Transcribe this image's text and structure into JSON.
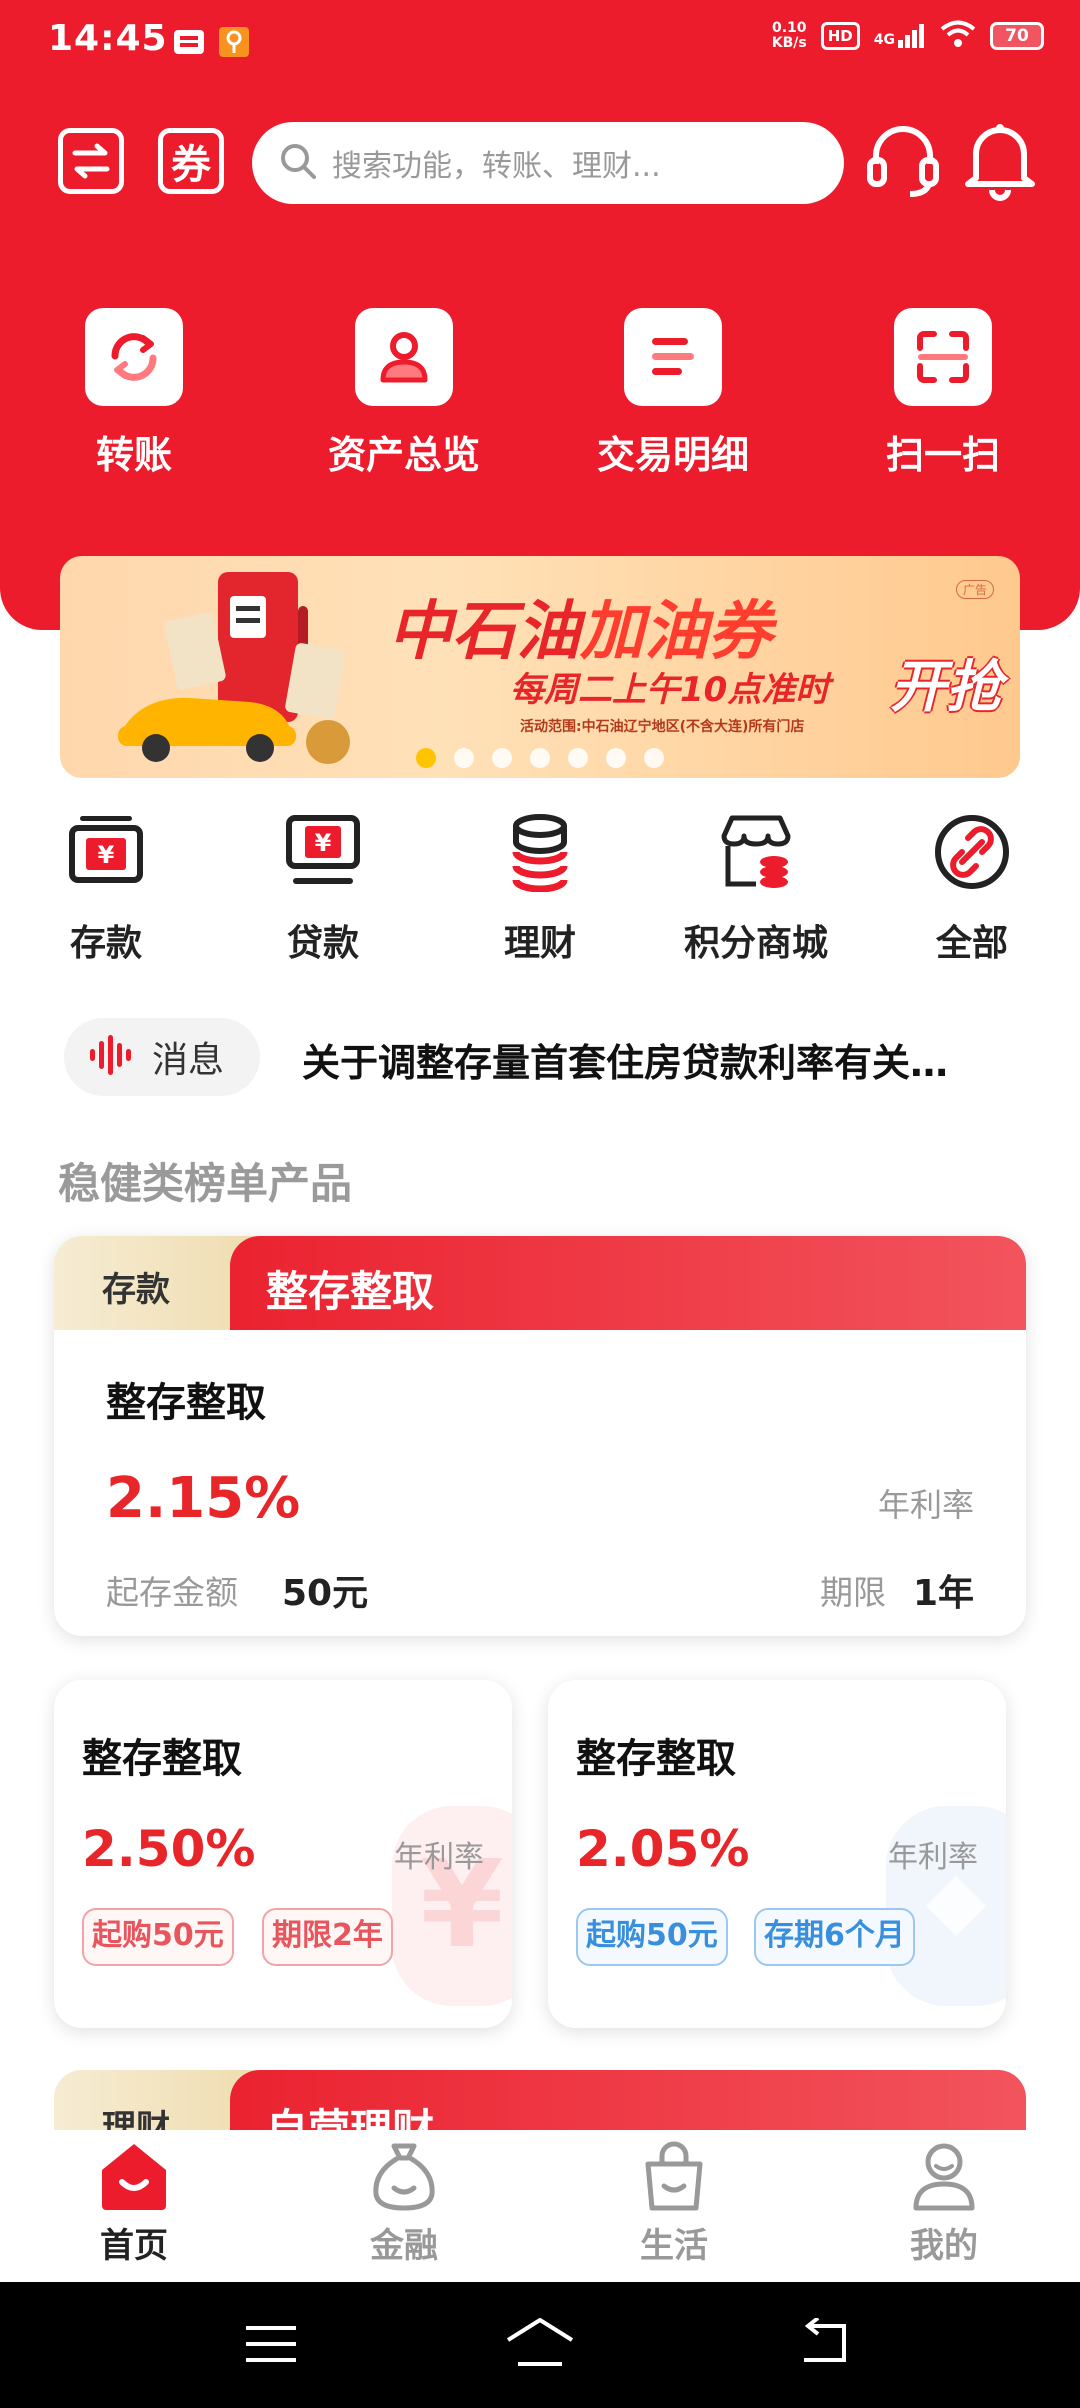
{
  "status_bar": {
    "time": "14:45",
    "net_speed_value": "0.10",
    "net_speed_unit": "KB/s",
    "hd": "HD",
    "network": "4G",
    "battery": "70"
  },
  "top_bar": {
    "search_placeholder": "搜索功能，转账、理财...",
    "coupon_icon_label": "券"
  },
  "quick_actions": [
    {
      "label": "转账",
      "icon": "transfer-icon"
    },
    {
      "label": "资产总览",
      "icon": "person-icon"
    },
    {
      "label": "交易明细",
      "icon": "list-icon"
    },
    {
      "label": "扫一扫",
      "icon": "scan-icon"
    }
  ],
  "banner": {
    "title_part1": "中石油",
    "title_part2": "加油券",
    "subtitle": "每周二上午10点准时",
    "subtitle_highlight": "开抢",
    "note": "活动范围:中石油辽宁地区(不含大连)所有门店",
    "ad_tag": "广告",
    "page_count": 7,
    "active_page": 1
  },
  "categories": [
    {
      "label": "存款",
      "icon": "deposit-icon"
    },
    {
      "label": "贷款",
      "icon": "loan-icon"
    },
    {
      "label": "理财",
      "icon": "wealth-icon"
    },
    {
      "label": "积分商城",
      "icon": "store-icon"
    },
    {
      "label": "全部",
      "icon": "link-icon"
    }
  ],
  "message": {
    "label": "消息",
    "text": "关于调整存量首套住房贷款利率有关…"
  },
  "section_title": "稳健类榜单产品",
  "featured_card": {
    "tag": "存款",
    "header": "整存整取",
    "name": "整存整取",
    "rate": "2.15%",
    "rate_label": "年利率",
    "min_label": "起存金额",
    "min_value": "50元",
    "term_label": "期限",
    "term_value": "1年"
  },
  "small_cards": [
    {
      "name": "整存整取",
      "rate": "2.50%",
      "rate_label": "年利率",
      "chip1": "起购50元",
      "chip2": "期限2年",
      "theme": "red"
    },
    {
      "name": "整存整取",
      "rate": "2.05%",
      "rate_label": "年利率",
      "chip1": "起购50元",
      "chip2": "存期6个月",
      "theme": "blue"
    }
  ],
  "partial_card": {
    "tag": "理财",
    "header": "自营理财"
  },
  "bottom_nav": [
    {
      "label": "首页",
      "icon": "home-icon",
      "active": true
    },
    {
      "label": "金融",
      "icon": "money-bag-icon",
      "active": false
    },
    {
      "label": "生活",
      "icon": "shopping-bag-icon",
      "active": false
    },
    {
      "label": "我的",
      "icon": "profile-icon",
      "active": false
    }
  ],
  "colors": {
    "brand_red": "#ec1c2d",
    "rate_red": "#e8262a",
    "chip_blue": "#3a8fdc"
  }
}
